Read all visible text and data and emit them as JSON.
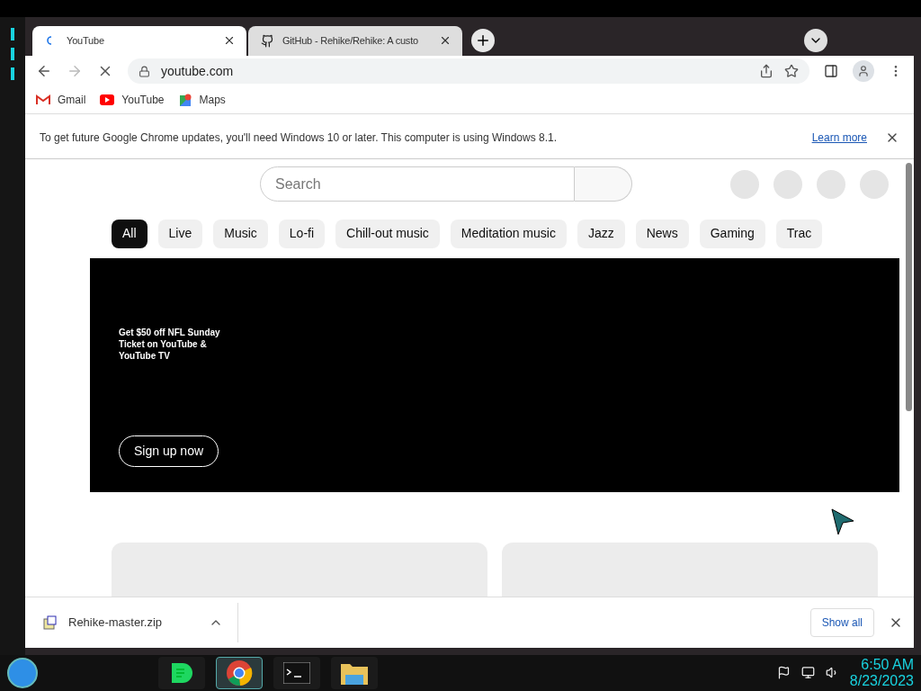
{
  "tabs": [
    {
      "title": "YouTube",
      "selected": true,
      "kind": "loading"
    },
    {
      "title": "GitHub - Rehike/Rehike: A custo",
      "selected": false,
      "kind": "github"
    }
  ],
  "address": "youtube.com",
  "bookmarks": [
    {
      "label": "Gmail",
      "kind": "mail"
    },
    {
      "label": "YouTube",
      "kind": "play"
    },
    {
      "label": "Maps",
      "kind": "map"
    }
  ],
  "infobar": {
    "text": "To get future Google Chrome updates, you'll need Windows 10 or later. This computer is using Windows 8.1.",
    "link": "Learn more"
  },
  "page": {
    "search_placeholder": "Search",
    "chips": [
      {
        "label": "All",
        "selected": true
      },
      {
        "label": "Live",
        "selected": false
      },
      {
        "label": "Music",
        "selected": false
      },
      {
        "label": "Lo-fi",
        "selected": false
      },
      {
        "label": "Chill-out music",
        "selected": false
      },
      {
        "label": "Meditation music",
        "selected": false
      },
      {
        "label": "Jazz",
        "selected": false
      },
      {
        "label": "News",
        "selected": false
      },
      {
        "label": "Gaming",
        "selected": false
      },
      {
        "label": "Trac",
        "selected": false
      }
    ],
    "ad": {
      "headline": "Get $50 off NFL Sunday Ticket on YouTube & YouTube TV",
      "button": "Sign up now"
    }
  },
  "download": {
    "filename": "Rehike-master.zip",
    "show_all": "Show all"
  },
  "taskbar": {
    "apps": [
      {
        "kind": "notes",
        "selected": false
      },
      {
        "kind": "chrome",
        "selected": true
      },
      {
        "kind": "terminal",
        "selected": false
      },
      {
        "kind": "folder",
        "selected": false
      }
    ],
    "time": "6:50 AM",
    "date": "8/23/2023"
  }
}
